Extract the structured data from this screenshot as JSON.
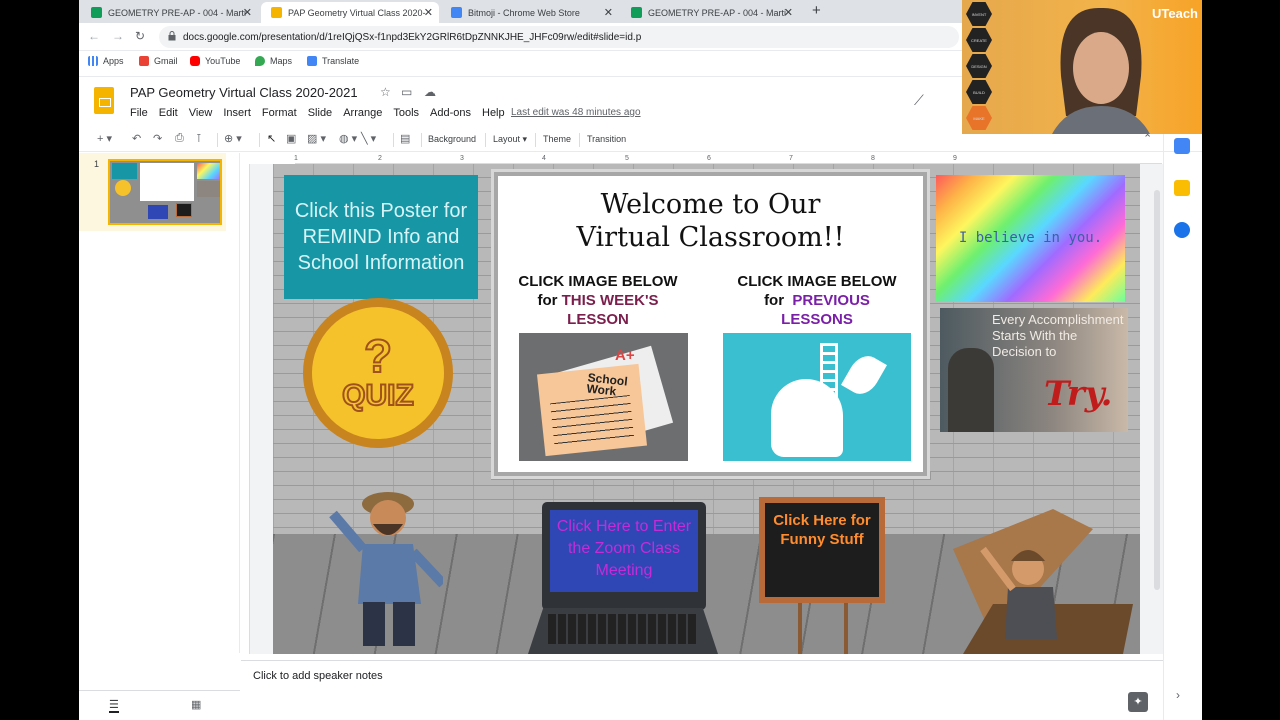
{
  "tabs": [
    {
      "title": "GEOMETRY PRE-AP - 004 - Marti",
      "favicon_color": "#0f9d58",
      "active": false
    },
    {
      "title": "PAP Geometry Virtual Class 2020-",
      "favicon_color": "#f4b400",
      "active": true
    },
    {
      "title": "Bitmoji - Chrome Web Store",
      "favicon_color": "#4285f4",
      "active": false
    },
    {
      "title": "GEOMETRY PRE-AP - 004 - Marti",
      "favicon_color": "#0f9d58",
      "active": false
    }
  ],
  "address": {
    "url": "docs.google.com/presentation/d/1reIQjQSx-f1npd3EkY2GRlR6tDpZNNKJHE_JHFc09rw/edit#slide=id.p"
  },
  "bookmarks": [
    "Apps",
    "Gmail",
    "YouTube",
    "Maps",
    "Translate"
  ],
  "doc": {
    "title": "PAP Geometry Virtual Class 2020-2021",
    "menus": [
      "File",
      "Edit",
      "View",
      "Insert",
      "Format",
      "Slide",
      "Arrange",
      "Tools",
      "Add-ons",
      "Help"
    ],
    "last_edit": "Last edit was 48 minutes ago"
  },
  "toolbar": {
    "background": "Background",
    "layout": "Layout",
    "theme": "Theme",
    "transition": "Transition"
  },
  "ruler": {
    "marks": [
      "1",
      "2",
      "3",
      "4",
      "5",
      "6",
      "7",
      "8",
      "9"
    ]
  },
  "filmstrip": {
    "slide_number": "1"
  },
  "slide": {
    "poster": "Click this Poster for REMIND Info and School Information",
    "quiz_mark": "?",
    "quiz_word": "QUIZ",
    "welcome_line1": "Welcome to Our",
    "welcome_line2": "Virtual Classroom!!",
    "left_head_line1": "CLICK IMAGE BELOW",
    "left_head_for": "for",
    "left_head_highlight": "THIS WEEK'S",
    "left_head_line3": "LESSON",
    "right_head_line1": "CLICK IMAGE BELOW",
    "right_head_for": "for",
    "right_head_highlight": "PREVIOUS",
    "right_head_line3": "LESSONS",
    "school_work": "School Work",
    "aplus": "A+",
    "believe": "I believe in you.",
    "accomplishment": "Every Accomplishment Starts With the Decision to",
    "try": "Try.",
    "zoom": "Click Here to Enter the Zoom Class Meeting",
    "funny": "Click Here for Funny Stuff"
  },
  "notes": {
    "placeholder": "Click to add speaker notes"
  },
  "webcam": {
    "brand": "UTeach",
    "hexes": [
      "INVENT",
      "CREATE",
      "DESIGN",
      "BUILD",
      "MAKE"
    ]
  }
}
